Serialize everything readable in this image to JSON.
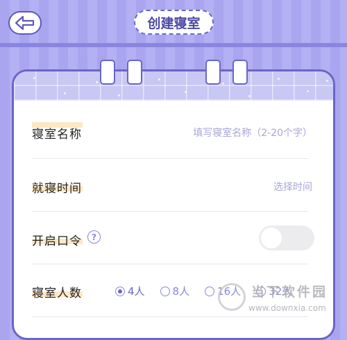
{
  "header": {
    "title": "创建寝室"
  },
  "form": {
    "dorm_name": {
      "label": "寝室名称",
      "placeholder": "填写寝室名称（2-20个字）"
    },
    "bedtime": {
      "label": "就寝时间",
      "placeholder": "选择时间"
    },
    "password": {
      "label": "开启口令",
      "help": "?",
      "enabled": false
    },
    "members": {
      "label": "寝室人数",
      "options": [
        "4人",
        "8人",
        "16人",
        "32人"
      ],
      "selected": "4人"
    }
  },
  "watermark": {
    "title": "当下软件园",
    "url": "www.downxia.com"
  },
  "colors": {
    "primary": "#6b67c4",
    "background": "#aeabf1",
    "label_highlight": "#fde8c4"
  }
}
